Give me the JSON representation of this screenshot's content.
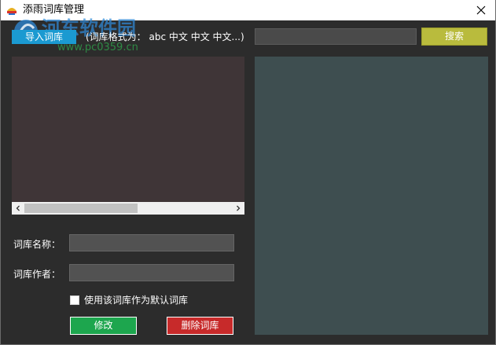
{
  "window": {
    "title": "添雨词库管理",
    "close_icon": "close-icon",
    "app_icon": "app-logo-icon"
  },
  "watermark": {
    "brand": "河东软件园",
    "url": "www.pc0359.cn"
  },
  "toolbar": {
    "import_label": "导入词库",
    "format_hint": "(词库格式为： abc 中文 中文 中文...)",
    "search_value": "",
    "search_placeholder": "",
    "search_label": "搜索"
  },
  "form": {
    "name_label": "词库名称：",
    "name_value": "",
    "author_label": "词库作者：",
    "author_value": "",
    "default_checkbox_label": "使用该词库作为默认词库",
    "default_checked": false,
    "modify_label": "修改",
    "delete_label": "删除词库"
  },
  "colors": {
    "window_bg": "#2c2c2c",
    "import_button": "#1b9ad1",
    "search_button": "#b9bb3d",
    "list_panel": "#3f3537",
    "right_panel": "#3e4e50",
    "modify_button": "#1da64e",
    "delete_button": "#c72a2a"
  }
}
